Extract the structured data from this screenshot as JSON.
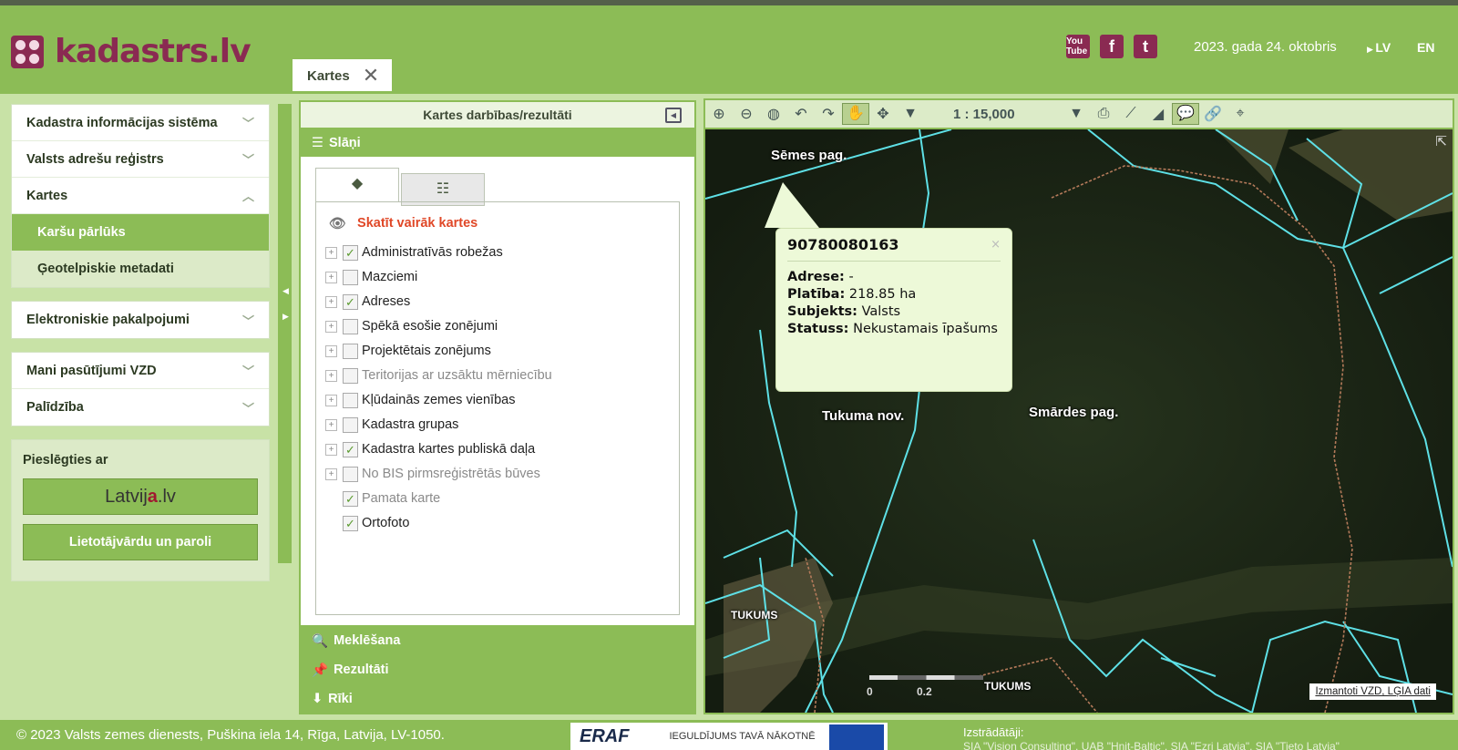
{
  "header": {
    "logo_text": "kadastrs.lv",
    "date": "2023. gada 24. oktobris",
    "lang_lv": "LV",
    "lang_en": "EN",
    "social": {
      "youtube": "You Tube",
      "facebook": "f",
      "twitter": "t"
    }
  },
  "tab": {
    "label": "Kartes",
    "close": "✕"
  },
  "nav": {
    "kis": "Kadastra informācijas sistēma",
    "var": "Valsts adrešu reģistrs",
    "kartes": "Kartes",
    "karsu_parluks": "Karšu pārlūks",
    "geotelpiskie": "Ģeotelpiskie metadati",
    "elektroniskie": "Elektroniskie pakalpojumi",
    "mani": "Mani pasūtījumi VZD",
    "palidziba": "Palīdzība"
  },
  "login": {
    "title": "Pieslēgties ar",
    "latvija_pre": "Latvij",
    "latvija_mid": "a",
    "latvija_post": ".lv",
    "password": "Lietotājvārdu un paroli"
  },
  "panel": {
    "title": "Kartes darbības/rezultāti",
    "sections": {
      "slani": "Slāņi",
      "meklesana": "Meklēšana",
      "rezultati": "Rezultāti",
      "riki": "Rīki"
    },
    "more_maps": "Skatīt vairāk kartes",
    "layers": [
      {
        "label": "Administratīvās robežas",
        "checked": true
      },
      {
        "label": "Mazciemi",
        "checked": false
      },
      {
        "label": "Adreses",
        "checked": true
      },
      {
        "label": "Spēkā esošie zonējumi",
        "checked": false
      },
      {
        "label": "Projektētais zonējums",
        "checked": false
      },
      {
        "label": "Teritorijas ar uzsāktu mērniecību",
        "checked": false
      },
      {
        "label": "Kļūdainās zemes vienības",
        "checked": false
      },
      {
        "label": "Kadastra grupas",
        "checked": false
      },
      {
        "label": "Kadastra kartes publiskā daļa",
        "checked": true
      },
      {
        "label": "No BIS pirmsreģistrētās būves",
        "checked": false
      },
      {
        "label": "Pamata karte",
        "checked": true
      },
      {
        "label": "Ortofoto",
        "checked": true
      }
    ]
  },
  "map": {
    "scale": "1 : 15,000",
    "labels": {
      "semes": "Sēmes pag.",
      "tukuma_nov": "Tukuma nov.",
      "smardes": "Smārdes pag.",
      "tukums": "TUKUMS"
    },
    "popup": {
      "cadastre": "90780080163",
      "close": "×",
      "address_label": "Adrese:",
      "address_value": "-",
      "area_label": "Platība:",
      "area_value": "218.85 ha",
      "subject_label": "Subjekts:",
      "subject_value": "Valsts",
      "status_label": "Statuss:",
      "status_value": "Nekustamais īpašums"
    },
    "scale_zero": "0",
    "scale_mid": "0.2",
    "attribution": "Izmantoti VZD, LĢIA dati"
  },
  "footer": {
    "copyright": "© 2023 Valsts zemes dienests, Puškina iela 14, Rīga, Latvija, LV-1050.",
    "eraf": "ERAF",
    "eraf_slogan": "IEGULDĪJUMS TAVĀ NĀKOTNĒ",
    "dev_title": "Izstrādātāji:",
    "dev_names": "SIA \"Vision Consulting\", UAB \"Hnit-Baltic\", SIA \"Ezri Latvia\", SIA \"Tieto Latvia\""
  },
  "colors": {
    "accent": "#8cbc56",
    "brand": "#8a2a52",
    "link_red": "#e04828"
  }
}
